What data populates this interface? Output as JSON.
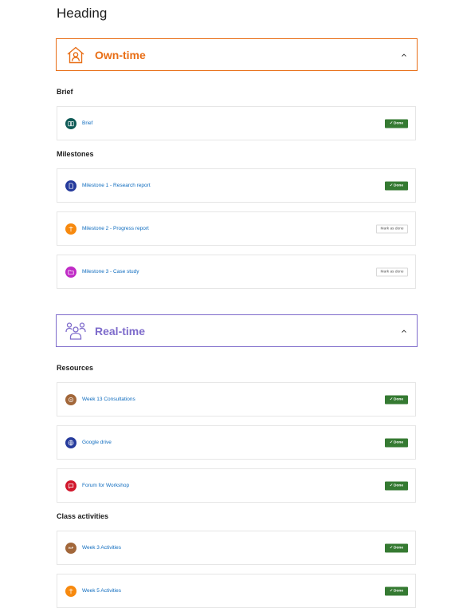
{
  "page": {
    "heading": "Heading"
  },
  "sections": {
    "own_time": {
      "title": "Own-time",
      "color": "#e86e16",
      "icon": "house-person-icon",
      "groups": {
        "brief": {
          "title": "Brief",
          "items": [
            {
              "label": "Brief",
              "icon": "book-icon",
              "icon_color": "#105b57",
              "status": "Done"
            }
          ]
        },
        "milestones": {
          "title": "Milestones",
          "items": [
            {
              "label": "Milestone 1 - Research report",
              "icon": "file-icon",
              "icon_color": "#263b9c",
              "status": "Done"
            },
            {
              "label": "Milestone 2 - Progress report",
              "icon": "assignment-icon",
              "icon_color": "#f7890e",
              "status": "Mark as done"
            },
            {
              "label": "Milestone 3 - Case study",
              "icon": "folder-icon",
              "icon_color": "#c02bc6",
              "status": "Mark as done"
            }
          ]
        }
      }
    },
    "real_time": {
      "title": "Real-time",
      "color": "#7e6bcb",
      "icon": "people-group-icon",
      "groups": {
        "resources": {
          "title": "Resources",
          "items": [
            {
              "label": "Week 13 Consultations",
              "icon": "chooser-icon",
              "icon_color": "#a2673a",
              "status": "Done"
            },
            {
              "label": "Google drive",
              "icon": "globe-icon",
              "icon_color": "#263b9c",
              "status": "Done"
            },
            {
              "label": "Forum for Workshop",
              "icon": "forum-icon",
              "icon_color": "#d1172c",
              "status": "Done"
            }
          ]
        },
        "class_activities": {
          "title": "Class activities",
          "items": [
            {
              "label": "Week 3 Activities",
              "icon": "h5p-icon",
              "icon_glyph": "H•P",
              "icon_color": "#a2673a",
              "status": "Done"
            },
            {
              "label": "Week 5 Activities",
              "icon": "assignment-icon",
              "icon_color": "#f7890e",
              "status": "Done"
            }
          ]
        }
      }
    }
  }
}
